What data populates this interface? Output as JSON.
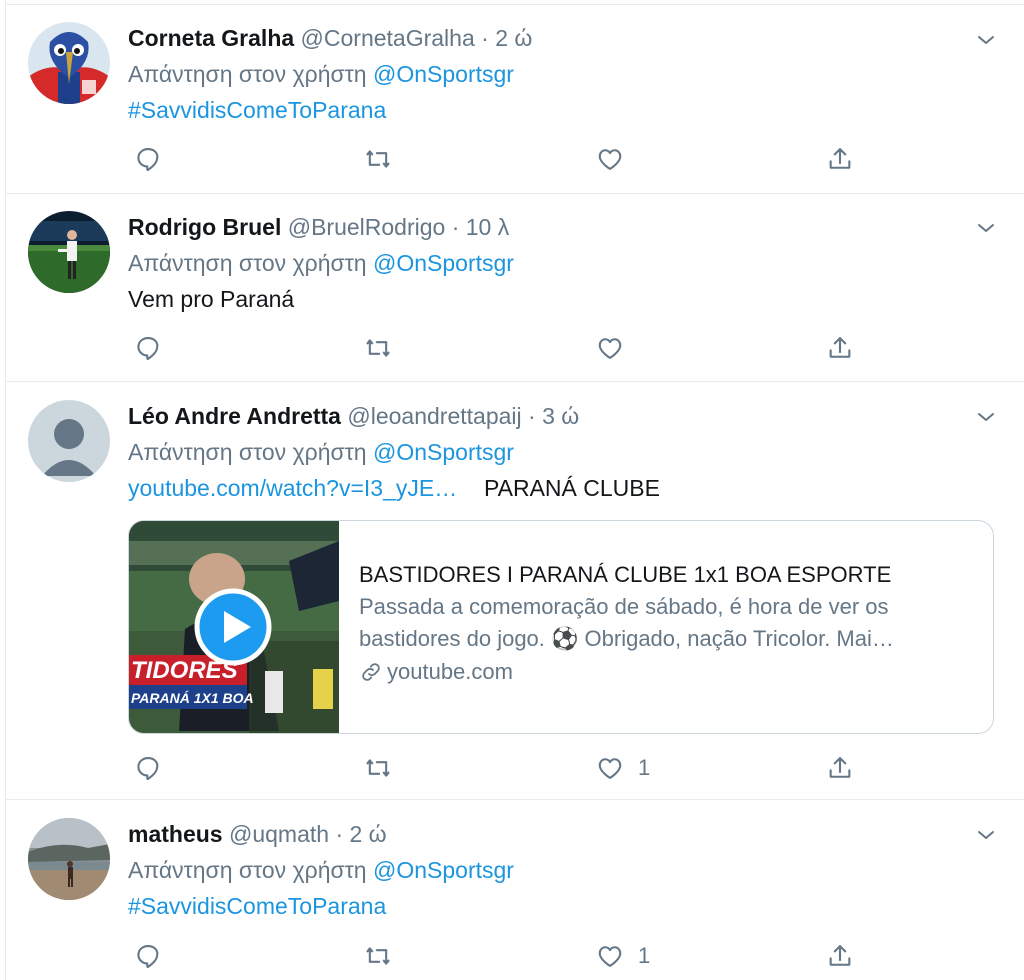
{
  "colors": {
    "accent": "#1b95e0",
    "muted": "#657786",
    "text": "#14171a",
    "border": "#e6ecf0"
  },
  "reply_prefix": "Απάντηση στον χρήστη",
  "tweets": [
    {
      "name": "Corneta Gralha",
      "handle": "@CornetaGralha",
      "time": "· 2 ώ",
      "reply_to": "@OnSportsgr",
      "text": "#SavvidisComeToParana",
      "likes": ""
    },
    {
      "name": "Rodrigo Bruel",
      "handle": "@BruelRodrigo",
      "time": "· 10 λ",
      "reply_to": "@OnSportsgr",
      "text": "Vem pro Paraná",
      "likes": ""
    },
    {
      "name": "Léo Andre Andretta",
      "handle": "@leoandrettapaij",
      "time": "· 3 ώ",
      "reply_to": "@OnSportsgr",
      "link": "youtube.com/watch?v=I3_yJE…",
      "text": "PARANÁ CLUBE",
      "likes": "1",
      "card": {
        "title": "BASTIDORES I PARANÁ CLUBE 1x1 BOA ESPORTE",
        "description_line1": "Passada a comemoração de sábado, é hora de ver os",
        "description_line2": "bastidores do jogo. ⚽ Obrigado, nação Tricolor. Mai…",
        "domain": "youtube.com",
        "thumb_text_1": "TIDORES",
        "thumb_text_2": "PARANÁ 1X1 BOA"
      }
    },
    {
      "name": "matheus",
      "handle": "@uqmath",
      "time": "· 2 ώ",
      "reply_to": "@OnSportsgr",
      "text": "#SavvidisComeToParana",
      "likes": "1"
    }
  ]
}
